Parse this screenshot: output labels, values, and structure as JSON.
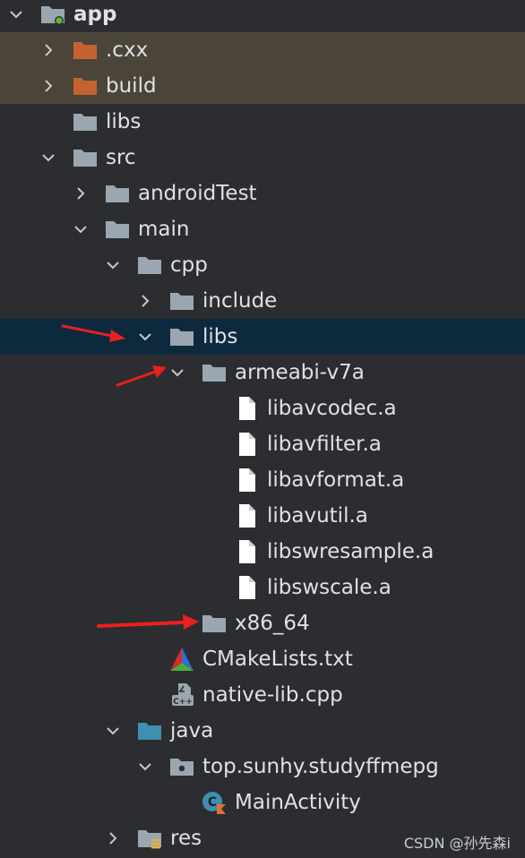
{
  "tree": [
    {
      "label": "app",
      "depth": 0,
      "chevron": "expanded",
      "icon": "module-folder-icon",
      "state": "normal",
      "bold": true
    },
    {
      "label": ".cxx",
      "depth": 1,
      "chevron": "collapsed",
      "icon": "folder-excluded-icon",
      "state": "excluded"
    },
    {
      "label": "build",
      "depth": 1,
      "chevron": "collapsed",
      "icon": "folder-excluded-icon",
      "state": "excluded"
    },
    {
      "label": "libs",
      "depth": 1,
      "chevron": "none",
      "icon": "folder-icon",
      "state": "normal"
    },
    {
      "label": "src",
      "depth": 1,
      "chevron": "expanded",
      "icon": "folder-icon",
      "state": "normal"
    },
    {
      "label": "androidTest",
      "depth": 2,
      "chevron": "collapsed",
      "icon": "folder-icon",
      "state": "normal"
    },
    {
      "label": "main",
      "depth": 2,
      "chevron": "expanded",
      "icon": "folder-icon",
      "state": "normal"
    },
    {
      "label": "cpp",
      "depth": 3,
      "chevron": "expanded",
      "icon": "folder-icon",
      "state": "normal"
    },
    {
      "label": "include",
      "depth": 4,
      "chevron": "collapsed",
      "icon": "folder-icon",
      "state": "normal"
    },
    {
      "label": "libs",
      "depth": 4,
      "chevron": "expanded",
      "icon": "folder-icon",
      "state": "selected"
    },
    {
      "label": "armeabi-v7a",
      "depth": 5,
      "chevron": "expanded",
      "icon": "folder-icon",
      "state": "normal"
    },
    {
      "label": "libavcodec.a",
      "depth": 6,
      "chevron": "none",
      "icon": "file-icon",
      "state": "normal"
    },
    {
      "label": "libavfilter.a",
      "depth": 6,
      "chevron": "none",
      "icon": "file-icon",
      "state": "normal"
    },
    {
      "label": "libavformat.a",
      "depth": 6,
      "chevron": "none",
      "icon": "file-icon",
      "state": "normal"
    },
    {
      "label": "libavutil.a",
      "depth": 6,
      "chevron": "none",
      "icon": "file-icon",
      "state": "normal"
    },
    {
      "label": "libswresample.a",
      "depth": 6,
      "chevron": "none",
      "icon": "file-icon",
      "state": "normal"
    },
    {
      "label": "libswscale.a",
      "depth": 6,
      "chevron": "none",
      "icon": "file-icon",
      "state": "normal"
    },
    {
      "label": "x86_64",
      "depth": 5,
      "chevron": "none",
      "icon": "folder-icon",
      "state": "normal"
    },
    {
      "label": "CMakeLists.txt",
      "depth": 4,
      "chevron": "none",
      "icon": "cmake-icon",
      "state": "normal"
    },
    {
      "label": "native-lib.cpp",
      "depth": 4,
      "chevron": "none",
      "icon": "cpp-file-icon",
      "state": "normal"
    },
    {
      "label": "java",
      "depth": 3,
      "chevron": "expanded",
      "icon": "source-folder-icon",
      "state": "normal"
    },
    {
      "label": "top.sunhy.studyffmepg",
      "depth": 4,
      "chevron": "expanded",
      "icon": "package-icon",
      "state": "normal"
    },
    {
      "label": "MainActivity",
      "depth": 5,
      "chevron": "none",
      "icon": "kotlin-class-icon",
      "state": "normal"
    },
    {
      "label": "res",
      "depth": 3,
      "chevron": "collapsed",
      "icon": "resource-folder-icon",
      "state": "normal"
    }
  ],
  "watermark": "CSDN @孙先森i",
  "colors": {
    "background": "#2b2d30",
    "excluded_row": "#4a4538",
    "selected_row": "#0d293e",
    "folder": "#9aa7b0",
    "excluded_folder": "#c4632f",
    "source_folder": "#3e8fb0",
    "text": "#dfe1e5",
    "annotation_arrow": "#e8211d"
  }
}
